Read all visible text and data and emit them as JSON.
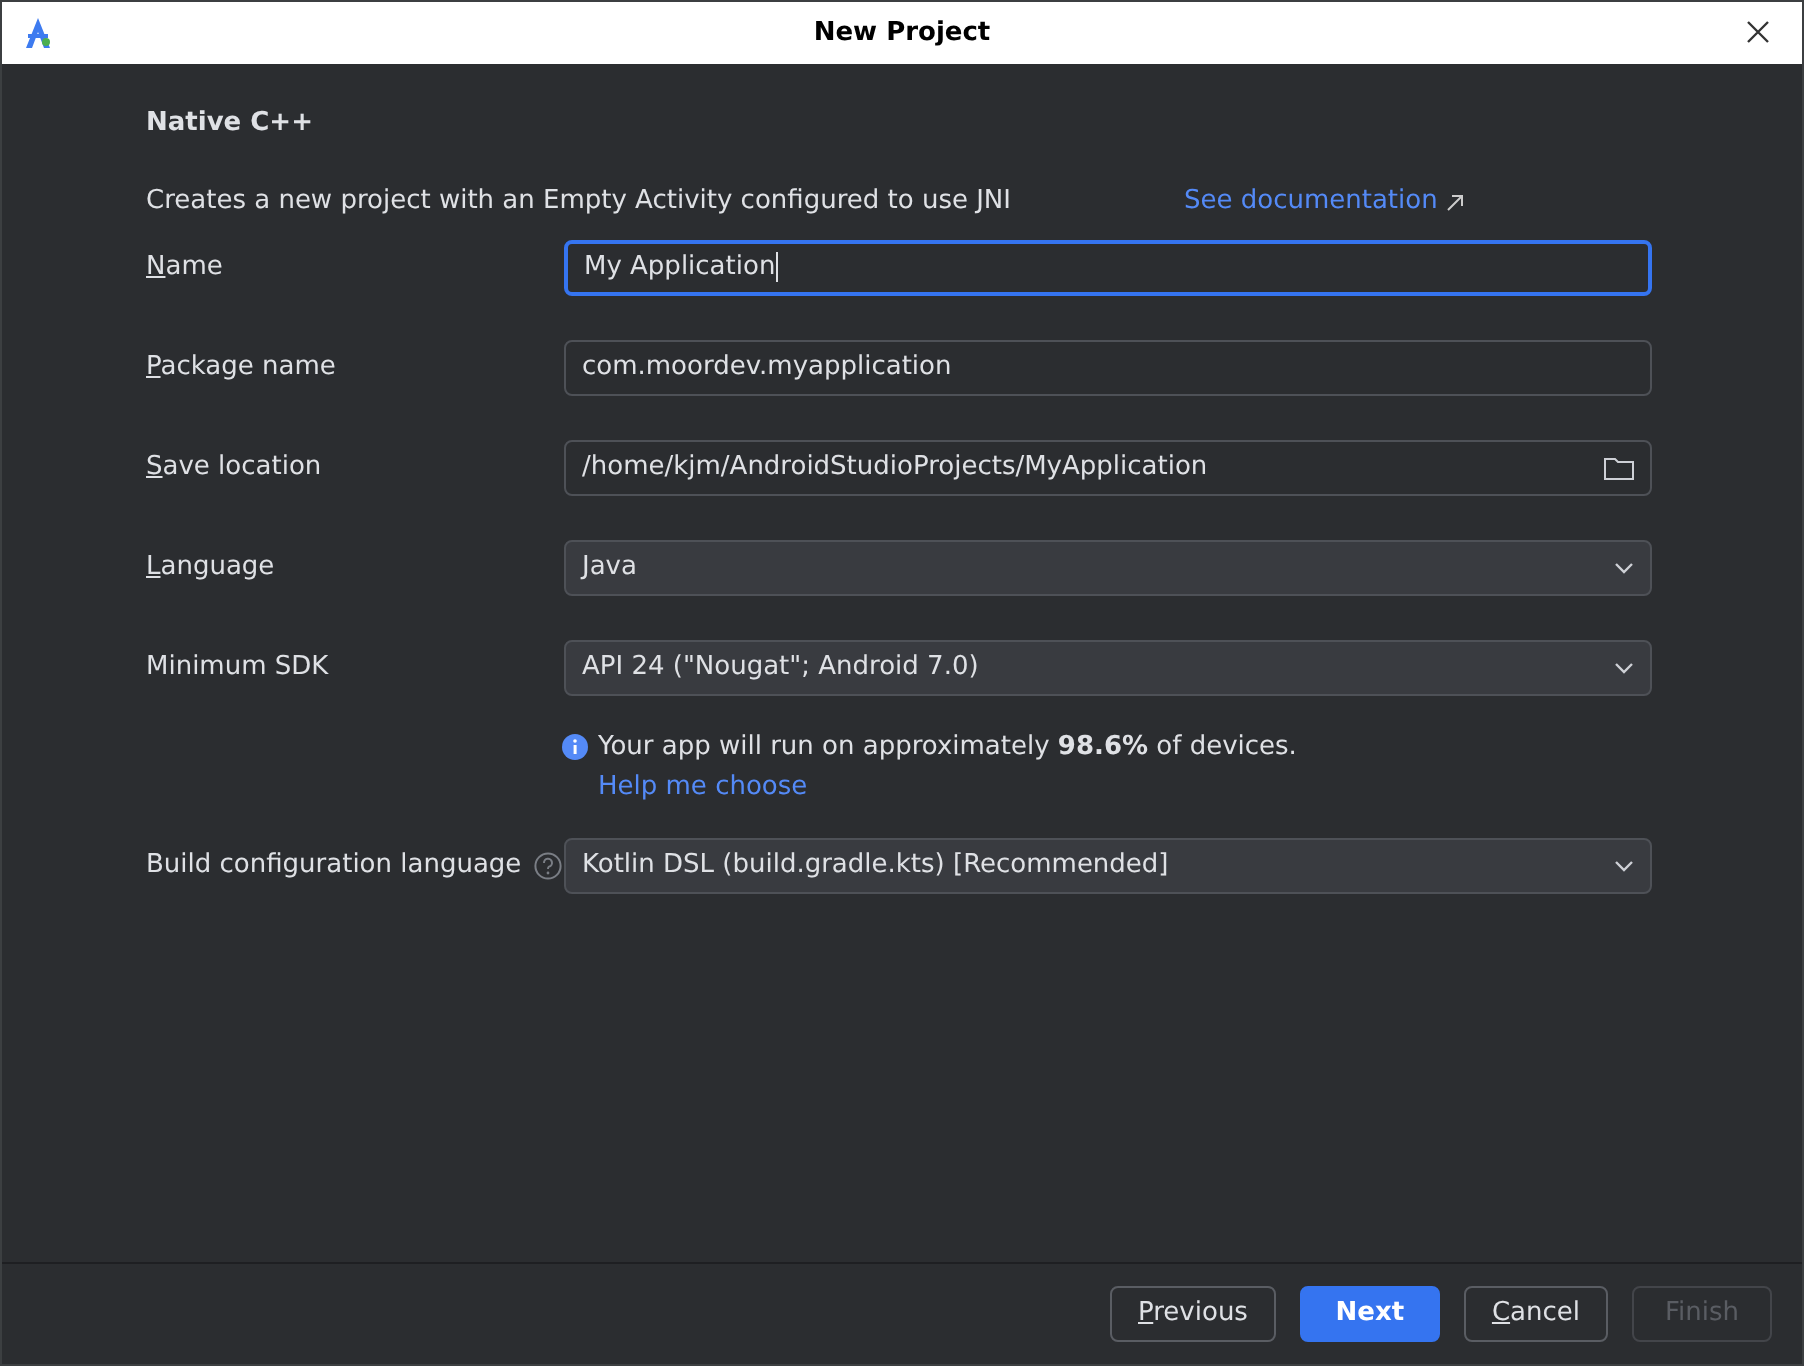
{
  "window": {
    "title": "New Project"
  },
  "heading": "Native C++",
  "description": "Creates a new project with an Empty Activity configured to use JNI",
  "doc_link": "See documentation",
  "fields": [
    {
      "label": "Name",
      "mnemonic": true,
      "kind": "text",
      "value": "My Application",
      "focused": true
    },
    {
      "label": "Package name",
      "mnemonic": true,
      "kind": "text",
      "value": "com.moordev.myapplication",
      "focused": false
    },
    {
      "label": "Save location",
      "mnemonic": true,
      "kind": "folder",
      "value": "/home/kjm/AndroidStudioProjects/MyApplication",
      "focused": false
    },
    {
      "label": "Language",
      "mnemonic": true,
      "kind": "dropdown",
      "value": "Java",
      "focused": false
    },
    {
      "label": "Minimum SDK",
      "mnemonic": false,
      "kind": "dropdown",
      "value": "API 24 (\"Nougat\"; Android 7.0)",
      "focused": false
    },
    {
      "kind": "info",
      "text": "Your app will run on approximately **98.6%** of devices.",
      "link": "Help me choose"
    },
    {
      "label": "Build configuration language",
      "mnemonic": false,
      "help": true,
      "kind": "dropdown",
      "value": "Kotlin DSL (build.gradle.kts) [Recommended]",
      "focused": false
    }
  ],
  "buttons": [
    {
      "label": "Previous",
      "mnemonic": true,
      "primary": false,
      "disabled": false
    },
    {
      "label": "Next",
      "mnemonic": false,
      "primary": true,
      "disabled": false
    },
    {
      "label": "Cancel",
      "mnemonic": true,
      "primary": false,
      "disabled": false
    },
    {
      "label": "Finish",
      "mnemonic": false,
      "primary": false,
      "disabled": true
    }
  ]
}
